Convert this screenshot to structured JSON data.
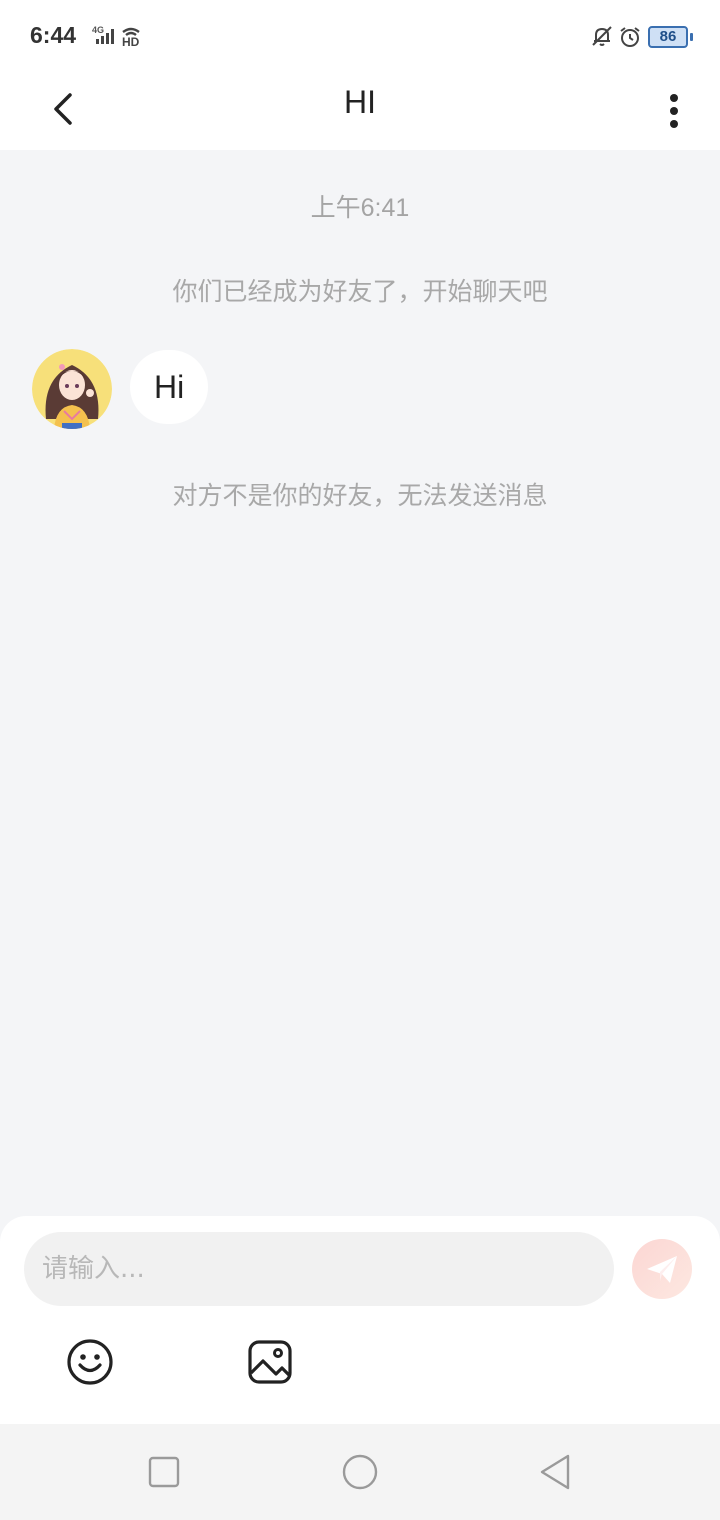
{
  "status_bar": {
    "time": "6:44",
    "network": "4G",
    "hd": "HD",
    "battery": "86",
    "icons": [
      "signal-icon",
      "hd-icon",
      "mute-bell-icon",
      "alarm-icon",
      "battery-icon"
    ]
  },
  "header": {
    "title": "HI",
    "back_icon": "chevron-left-icon",
    "more_icon": "more-vertical-icon"
  },
  "chat": {
    "timestamp": "上午6:41",
    "friend_notice": "你们已经成为好友了，开始聊天吧",
    "messages": [
      {
        "sender": "contact",
        "text": "Hi"
      }
    ],
    "not_friend_notice": "对方不是你的好友，无法发送消息"
  },
  "composer": {
    "placeholder": "请输入...",
    "value": "",
    "send_icon": "paper-plane-icon",
    "tools": [
      "emoji-icon",
      "image-icon"
    ]
  },
  "nav_bar": {
    "buttons": [
      "recent-apps-icon",
      "home-icon",
      "back-icon"
    ]
  },
  "colors": {
    "background": "#f4f5f7",
    "header": "#ffffff",
    "send_button": "#fcd6d3",
    "notice_text": "#a8a8a8"
  }
}
